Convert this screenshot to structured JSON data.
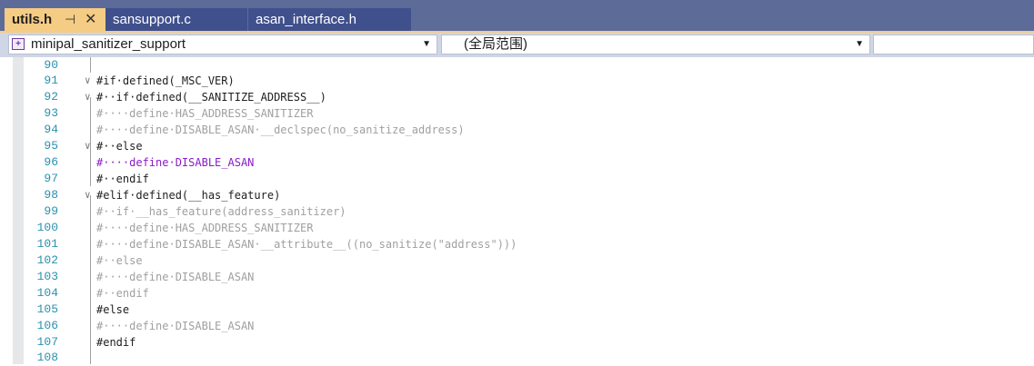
{
  "tabs": [
    {
      "label": "utils.h",
      "active": true,
      "pin_icon": "pin-icon",
      "close_icon": "close-icon"
    },
    {
      "label": "sansupport.c",
      "active": false
    },
    {
      "label": "asan_interface.h",
      "active": false
    }
  ],
  "navbar": {
    "project_combo": "minipal_sanitizer_support",
    "scope_combo": "(全局范围)",
    "member_combo": ""
  },
  "editor": {
    "lines": [
      {
        "num": "90",
        "text": ""
      },
      {
        "num": "91",
        "text": "#if·defined(_MSC_VER)"
      },
      {
        "num": "92",
        "text": "#··if·defined(__SANITIZE_ADDRESS__)"
      },
      {
        "num": "93",
        "text": "#····define·HAS_ADDRESS_SANITIZER"
      },
      {
        "num": "94",
        "text": "#····define·DISABLE_ASAN·__declspec(no_sanitize_address)"
      },
      {
        "num": "95",
        "text": "#··else"
      },
      {
        "num": "96",
        "text": "#····define·DISABLE_ASAN"
      },
      {
        "num": "97",
        "text": "#··endif"
      },
      {
        "num": "98",
        "text": "#elif·defined(__has_feature)"
      },
      {
        "num": "99",
        "text": "#··if·__has_feature(address_sanitizer)"
      },
      {
        "num": "100",
        "text": "#····define·HAS_ADDRESS_SANITIZER"
      },
      {
        "num": "101",
        "text": "#····define·DISABLE_ASAN·__attribute__((no_sanitize(\"address\")))"
      },
      {
        "num": "102",
        "text": "#··else"
      },
      {
        "num": "103",
        "text": "#····define·DISABLE_ASAN"
      },
      {
        "num": "104",
        "text": "#··endif"
      },
      {
        "num": "105",
        "text": "#else"
      },
      {
        "num": "106",
        "text": "#····define·DISABLE_ASAN"
      },
      {
        "num": "107",
        "text": "#endif"
      },
      {
        "num": "108",
        "text": ""
      }
    ]
  },
  "colors": {
    "tab_strip": "#5d6b99",
    "active_tab": "#f5cc84",
    "inactive_tab": "#40508d",
    "line_number": "#2b91af",
    "macro": "#8a1bc9",
    "inactive_code": "#a0a0a0"
  }
}
